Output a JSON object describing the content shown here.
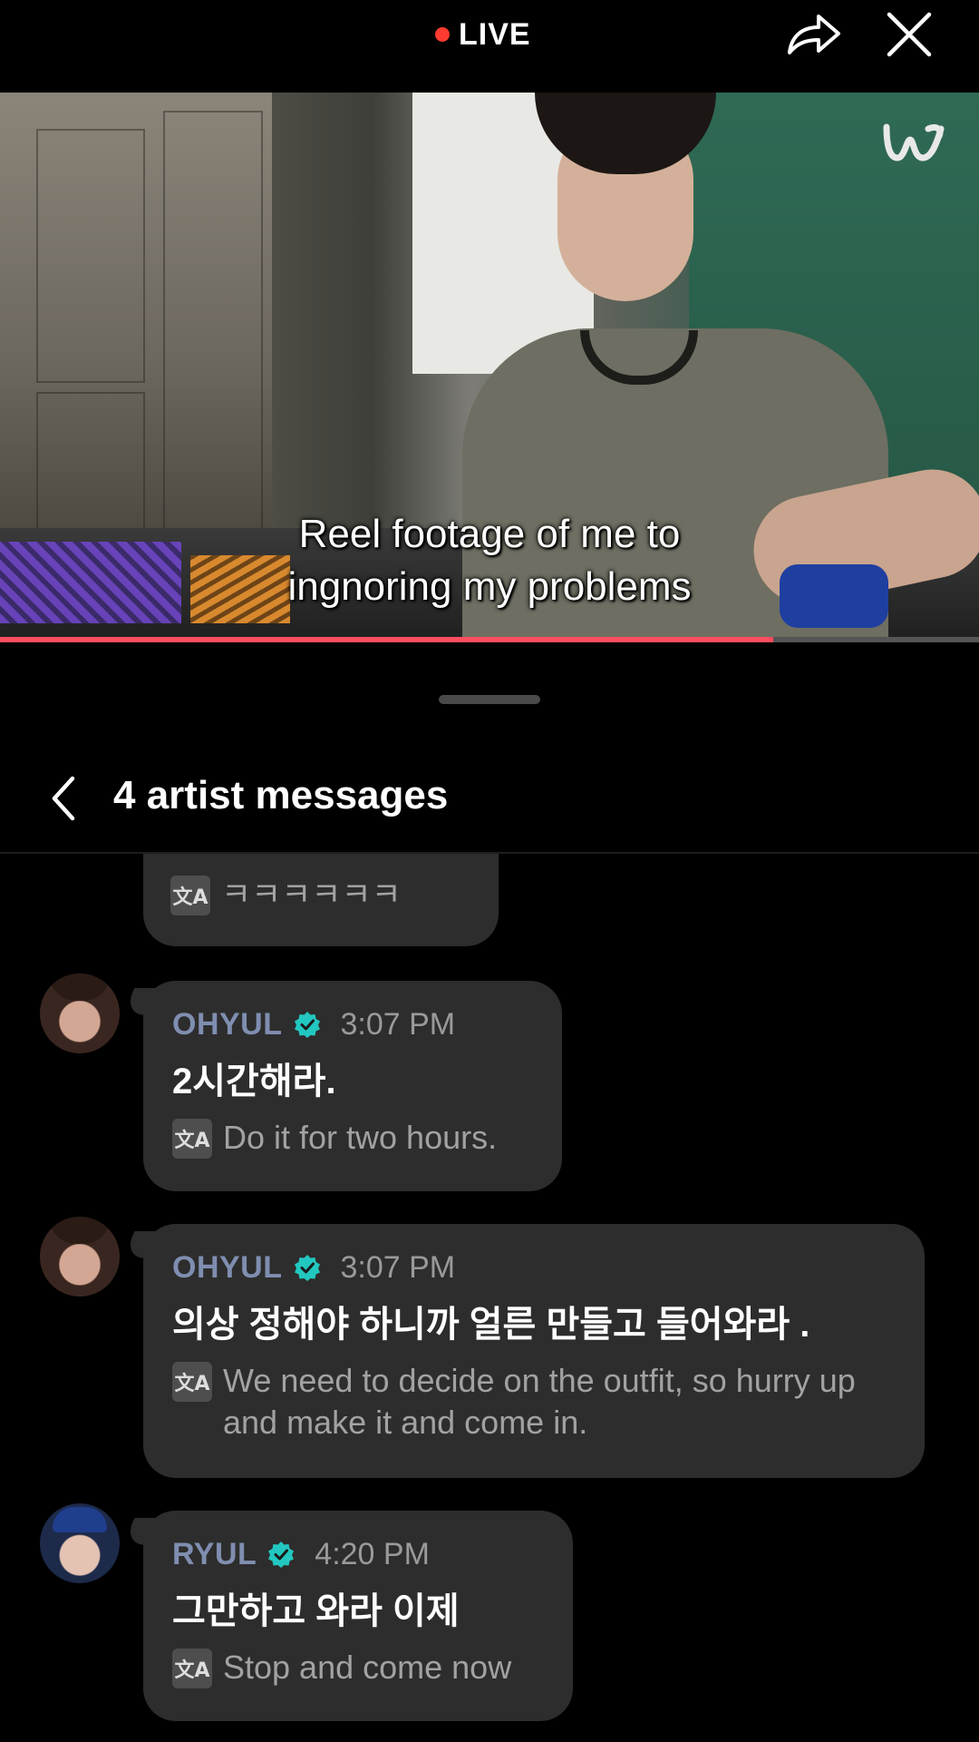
{
  "topbar": {
    "live_label": "LIVE",
    "share_icon": "share-arrow-icon",
    "close_icon": "close-icon"
  },
  "video": {
    "caption_line1": "Reel footage of me to",
    "caption_line2": "ingnoring my problems",
    "watermark_icon": "weverse-logo-icon",
    "progress_fraction": 0.79
  },
  "sheet": {
    "title": "4 artist messages",
    "back_icon": "chevron-left-icon"
  },
  "messages": [
    {
      "partial": true,
      "translation": "ㅋㅋㅋㅋㅋㅋ"
    },
    {
      "name": "OHYUL",
      "time": "3:07 PM",
      "original": "2시간해라.",
      "translation": "Do it for two hours."
    },
    {
      "name": "OHYUL",
      "time": "3:07 PM",
      "original": "의상 정해야 하니까 얼른 만들고 들어와라 .",
      "translation": "We need to decide on the outfit, so hurry up and make it and come in."
    },
    {
      "name": "RYUL",
      "time": "4:20 PM",
      "original": "그만하고 와라 이제",
      "translation": "Stop and come now"
    }
  ],
  "colors": {
    "live_dot": "#ff3b30",
    "progress": "#ff4d5e",
    "verified": "#22c7c0",
    "bubble": "#2d2d2d",
    "name": "#7f8eb0"
  }
}
